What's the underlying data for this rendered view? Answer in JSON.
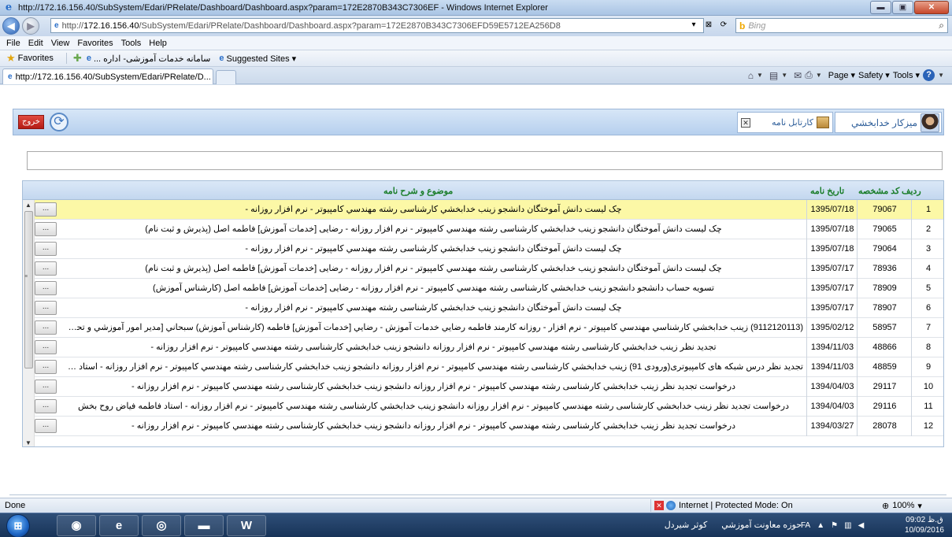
{
  "window": {
    "title": "http://172.16.156.40/SubSystem/Edari/PRelate/Dashboard/Dashboard.aspx?param=172E2870B343C7306EF - Windows Internet Explorer",
    "minimize": "▬",
    "maximize": "▣",
    "close": "✕"
  },
  "address": {
    "prefix": "http://",
    "host": "172.16.156.40",
    "path": "/SubSystem/Edari/PRelate/Dashboard/Dashboard.aspx?param=172E2870B343C7306EFD59E5712EA256D8",
    "search_placeholder": "Bing"
  },
  "menu": [
    "File",
    "Edit",
    "View",
    "Favorites",
    "Tools",
    "Help"
  ],
  "favorites": {
    "label": "Favorites",
    "item1": "... سامانه خدمات آموزشی- اداره",
    "item2": "Suggested Sites ▾"
  },
  "tab": {
    "title": "http://172.16.156.40/SubSystem/Edari/PRelate/D..."
  },
  "commandbar": [
    "Page ▾",
    "Safety ▾",
    "Tools ▾"
  ],
  "app": {
    "exit_label": "خروج",
    "user_name": "میزکار خدابخشي",
    "cartable_label": "کارتابل نامه",
    "box_close": "✕"
  },
  "grid": {
    "headers": {
      "idx": "ردیف",
      "code": "کد مشخصه",
      "date": "تاریخ نامه",
      "subject": "موضوع و شرح نامه"
    },
    "dots_label": "...",
    "rows": [
      {
        "idx": "1",
        "code": "79067",
        "date": "1395/07/18",
        "subject": "چک لیست دانش آموختگان دانشجو زینب خدابخشي کارشناسی رشته مهندسي کامپيوتر - نرم افزار روزانه -",
        "selected": true
      },
      {
        "idx": "2",
        "code": "79065",
        "date": "1395/07/18",
        "subject": "چک لیست دانش آموختگان دانشجو زینب خدابخشي کارشناسی رشته مهندسي کامپيوتر - نرم افزار روزانه - رضایی [خدمات آموزش] فاطمه اصل (پذیرش و ثبت نام)"
      },
      {
        "idx": "3",
        "code": "79064",
        "date": "1395/07/18",
        "subject": "چک لیست دانش آموختگان دانشجو زینب خدابخشي کارشناسی رشته مهندسي کامپيوتر - نرم افزار روزانه -"
      },
      {
        "idx": "4",
        "code": "78936",
        "date": "1395/07/17",
        "subject": "چک لیست دانش آموختگان دانشجو زینب خدابخشي کارشناسی رشته مهندسي کامپيوتر - نرم افزار روزانه - رضایی [خدمات آموزش] فاطمه اصل (پذیرش و ثبت نام)"
      },
      {
        "idx": "5",
        "code": "78909",
        "date": "1395/07/17",
        "subject": "تسویه حساب دانشجو دانشجو زینب خدابخشي کارشناسی رشته مهندسي کامپيوتر - نرم افزار روزانه - رضایی [خدمات آموزش] فاطمه اصل (کارشناس آموزش)"
      },
      {
        "idx": "6",
        "code": "78907",
        "date": "1395/07/17",
        "subject": "چک لیست دانش آموختگان دانشجو زینب خدابخشي کارشناسی رشته مهندسي کامپيوتر - نرم افزار روزانه -"
      },
      {
        "idx": "7",
        "code": "58957",
        "date": "1395/02/12",
        "subject": "(9112120113) زینب خدابخشي کارشناسي مهندسي کامپيوتر - نرم افزار - روزانه کارمند فاطمه رضایي خدمات آموزش - رضايي [خدمات آموزش] فاطمه (کارشناس آموزش) سبحاني [مدير امور آموزشي و تحصيلات..."
      },
      {
        "idx": "8",
        "code": "48866",
        "date": "1394/11/03",
        "subject": "تجدید نظر زینب خدابخشي کارشناسی رشته مهندسي کامپيوتر - نرم افزار روزانه دانشجو زینب خدابخشي کارشناسی رشته مهندسي کامپيوتر - نرم افزار روزانه -"
      },
      {
        "idx": "9",
        "code": "48859",
        "date": "1394/11/03",
        "subject": "تجدید نظر درس شبکه های کامپیوتری(ورودی 91) زینب خدابخشي کارشناسی رشته مهندسي کامپيوتر - نرم افزار روزانه دانشجو زینب خدابخشي کارشناسی رشته مهندسي کامپيوتر - نرم افزار روزانه - استاد مجتبی..."
      },
      {
        "idx": "10",
        "code": "29117",
        "date": "1394/04/03",
        "subject": "درخواست تجدید نظر زینب خدابخشي کارشناسی رشته مهندسي کامپيوتر - نرم افزار روزانه دانشجو زینب خدابخشي کارشناسی رشته مهندسي کامپيوتر - نرم افزار روزانه -"
      },
      {
        "idx": "11",
        "code": "29116",
        "date": "1394/04/03",
        "subject": "درخواست تجدید نظر زینب خدابخشي کارشناسی رشته مهندسي کامپيوتر - نرم افزار روزانه دانشجو زینب خدابخشي کارشناسی رشته مهندسي کامپيوتر - نرم افزار روزانه - استاد فاطمه فیاض روح بخش"
      },
      {
        "idx": "12",
        "code": "28078",
        "date": "1394/03/27",
        "subject": "درخواست تجدید نظر زینب خدابخشي کارشناسی رشته مهندسي کامپيوتر - نرم افزار روزانه دانشجو زینب خدابخشي کارشناسی رشته مهندسي کامپيوتر - نرم افزار روزانه -"
      }
    ]
  },
  "status": {
    "done": "Done",
    "zone": "Internet | Protected Mode: On",
    "zoom": "100%"
  },
  "taskbar": {
    "task1": "کوثر شیردل",
    "task2": "حوزه معاونت آموزشي",
    "lang": "FA",
    "time": "ق.ظ 09:02",
    "date": "10/09/2016"
  }
}
